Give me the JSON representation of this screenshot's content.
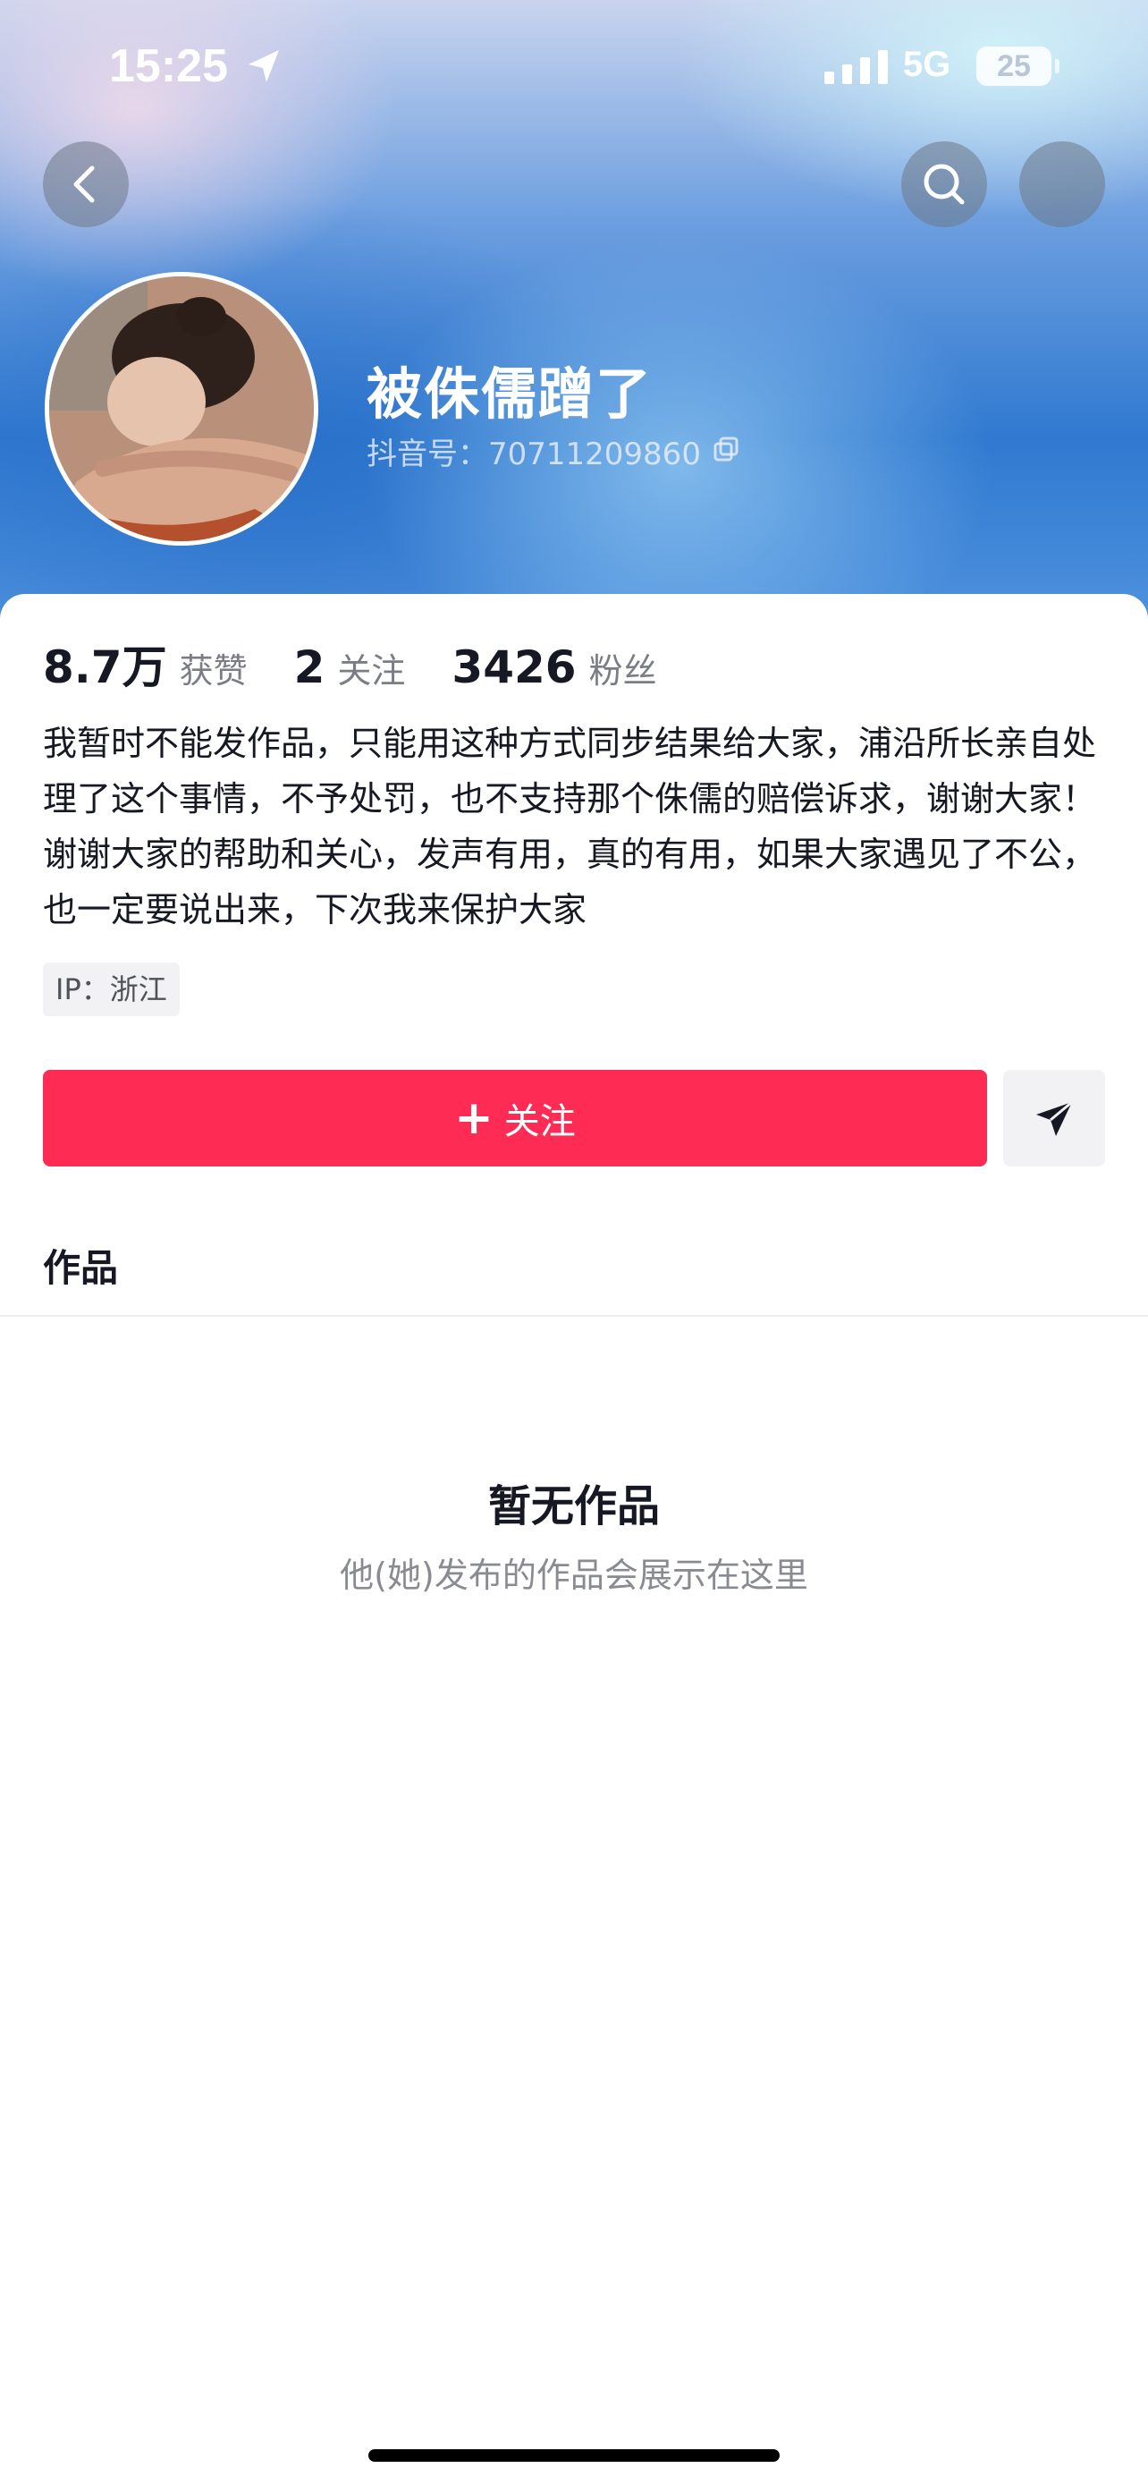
{
  "status_bar": {
    "time": "15:25",
    "network": "5G",
    "battery": "25",
    "icons": [
      "location-arrow-icon",
      "signal-icon",
      "battery-icon"
    ]
  },
  "nav": {
    "icons": [
      "back-icon",
      "search-icon",
      "more-icon"
    ]
  },
  "profile": {
    "username": "被侏儒蹭了",
    "douyin_id": "抖音号：70711209860",
    "stats": [
      {
        "value": "8.7万",
        "label": "获赞"
      },
      {
        "value": "2",
        "label": "关注"
      },
      {
        "value": "3426",
        "label": "粉丝"
      }
    ],
    "bio": "我暂时不能发作品，只能用这种方式同步结果给大家，浦沿所长亲自处理了这个事情，不予处罚，也不支持那个侏儒的赔偿诉求，谢谢大家！谢谢大家的帮助和关心，发声有用，真的有用，如果大家遇见了不公，也一定要说出来，下次我来保护大家",
    "ip": "IP：浙江"
  },
  "actions": {
    "follow_plus": "+",
    "follow_label": "关注"
  },
  "tabs": {
    "works": "作品"
  },
  "empty_state": {
    "title": "暂无作品",
    "subtitle": "他(她)发布的作品会展示在这里"
  },
  "colors": {
    "accent": "#fe2c55",
    "text_primary": "#161823",
    "text_secondary": "#7b7d85"
  }
}
